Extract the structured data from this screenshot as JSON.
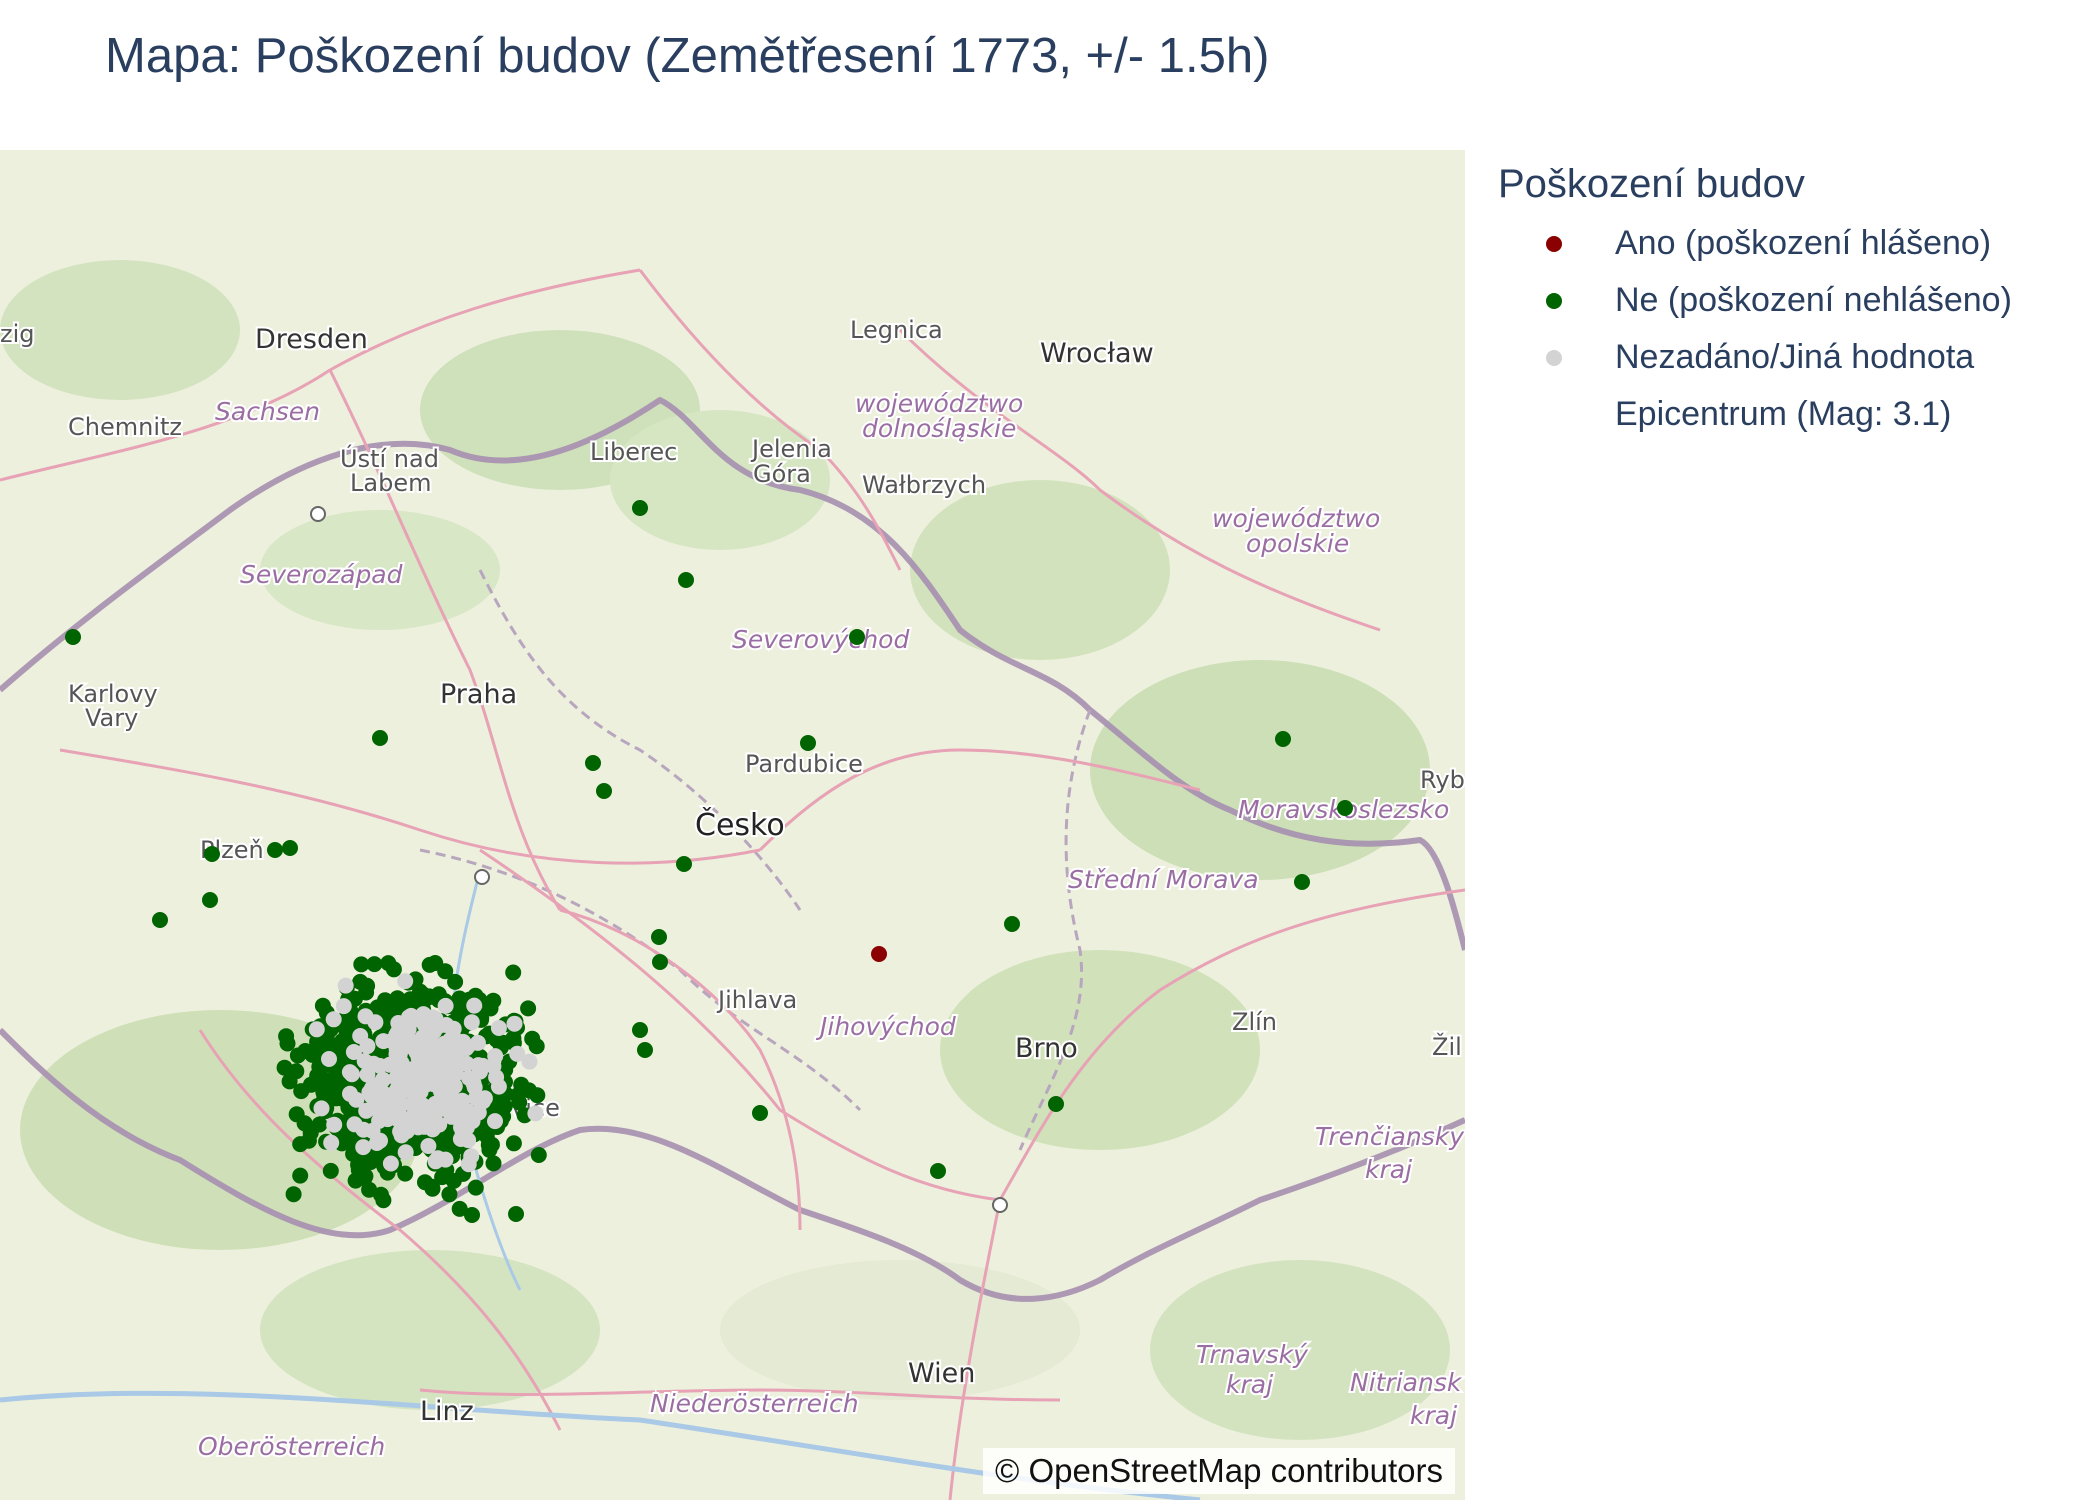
{
  "title": "Mapa: Poškození budov (Zemětřesení 1773, +/- 1.5h)",
  "attribution": "© OpenStreetMap contributors",
  "legend": {
    "title": "Poškození budov",
    "items": [
      {
        "label": "Ano (poškození hlášeno)",
        "color": "#8b0000",
        "marker": true
      },
      {
        "label": "Ne (poškození nehlášeno)",
        "color": "#006400",
        "marker": true
      },
      {
        "label": "Nezadáno/Jiná hodnota",
        "color": "#d3d3d3",
        "marker": true
      },
      {
        "label": "Epicentrum (Mag: 3.1)",
        "color": "",
        "marker": false
      }
    ]
  },
  "map_labels": [
    {
      "text": "Dresden",
      "kind": "city"
    },
    {
      "text": "Chemnitz",
      "kind": "town"
    },
    {
      "text": "Sachsen",
      "kind": "region"
    },
    {
      "text": "Ústí nad",
      "kind": "town"
    },
    {
      "text": "Labem",
      "kind": "town"
    },
    {
      "text": "Liberec",
      "kind": "town"
    },
    {
      "text": "Jelenia",
      "kind": "town"
    },
    {
      "text": "Góra",
      "kind": "town"
    },
    {
      "text": "Legnica",
      "kind": "town"
    },
    {
      "text": "Wrocław",
      "kind": "city"
    },
    {
      "text": "województwo",
      "kind": "region"
    },
    {
      "text": "dolnośląskie",
      "kind": "region"
    },
    {
      "text": "Wałbrzych",
      "kind": "town"
    },
    {
      "text": "województwo",
      "kind": "region"
    },
    {
      "text": "opolskie",
      "kind": "region"
    },
    {
      "text": "Severozápad",
      "kind": "region"
    },
    {
      "text": "Severovýchod",
      "kind": "region"
    },
    {
      "text": "Karlovy",
      "kind": "town"
    },
    {
      "text": "Vary",
      "kind": "town"
    },
    {
      "text": "Praha",
      "kind": "city"
    },
    {
      "text": "Pardubice",
      "kind": "town"
    },
    {
      "text": "Česko",
      "kind": "big"
    },
    {
      "text": "Moravskoslezsko",
      "kind": "region"
    },
    {
      "text": "Střední Morava",
      "kind": "region"
    },
    {
      "text": "Plzeň",
      "kind": "town"
    },
    {
      "text": "Jihlava",
      "kind": "town"
    },
    {
      "text": "Jihovýchod",
      "kind": "region"
    },
    {
      "text": "Brno",
      "kind": "city"
    },
    {
      "text": "Zlín",
      "kind": "town"
    },
    {
      "text": "České",
      "kind": "town"
    },
    {
      "text": "Budějovice",
      "kind": "town"
    },
    {
      "text": "Trenčiansky",
      "kind": "region"
    },
    {
      "text": "kraj",
      "kind": "region"
    },
    {
      "text": "Trnavský",
      "kind": "region"
    },
    {
      "text": "kraj",
      "kind": "region"
    },
    {
      "text": "Nitriansk",
      "kind": "region"
    },
    {
      "text": "kraj",
      "kind": "region"
    },
    {
      "text": "Wien",
      "kind": "city"
    },
    {
      "text": "Linz",
      "kind": "city"
    },
    {
      "text": "Niederösterreich",
      "kind": "region"
    },
    {
      "text": "Oberösterreich",
      "kind": "region"
    },
    {
      "text": "Ryb",
      "kind": "town"
    },
    {
      "text": "Žil",
      "kind": "town"
    },
    {
      "text": "zig",
      "kind": "town"
    }
  ]
}
